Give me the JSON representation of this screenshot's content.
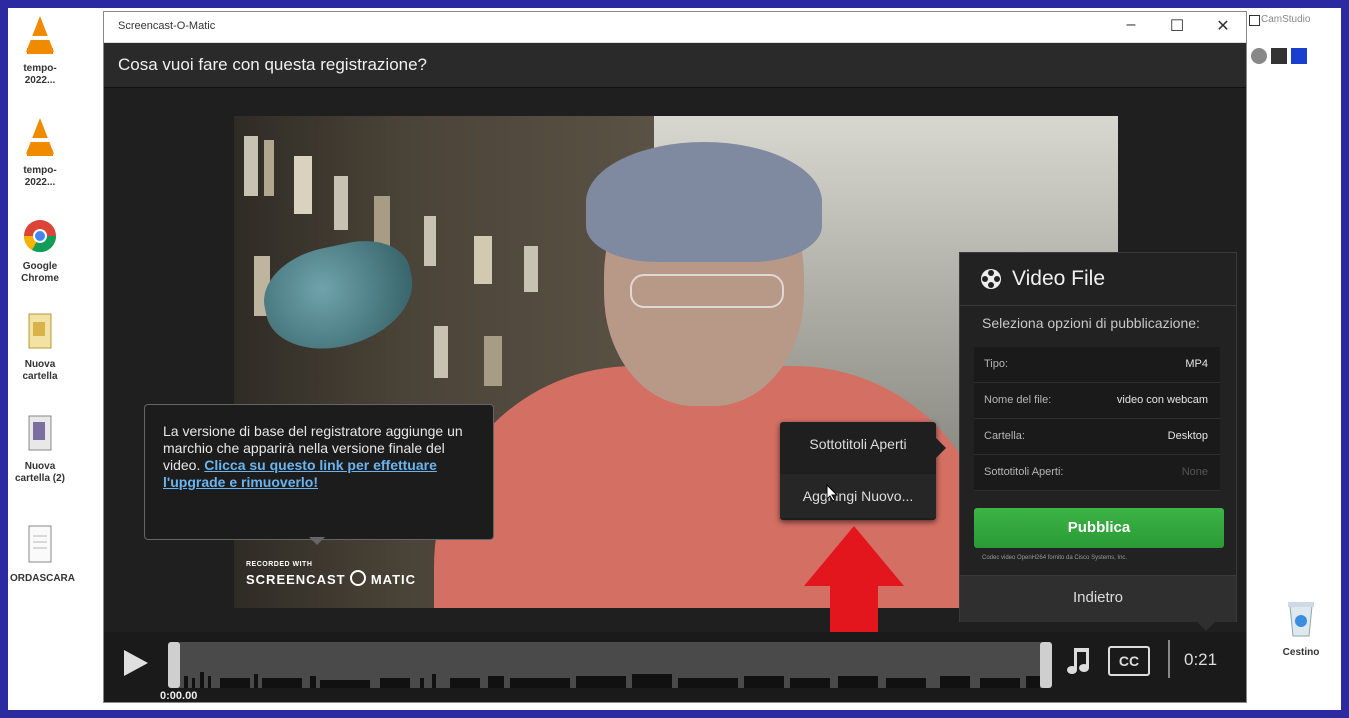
{
  "desktop": {
    "icons": [
      {
        "name": "vlc-icon",
        "label": "tempo-2022..."
      },
      {
        "name": "vlc-icon",
        "label": "tempo-2022..."
      },
      {
        "name": "chrome-icon",
        "label": "Google Chrome"
      },
      {
        "name": "folder-icon",
        "label": "Nuova cartella"
      },
      {
        "name": "folder-icon",
        "label": "Nuova cartella (2)"
      },
      {
        "name": "document-icon",
        "label": "ORDASCARA"
      }
    ],
    "recycle_bin_label": "Cestino",
    "camstudio": {
      "title": "CamStudio"
    }
  },
  "window": {
    "app_title": "Screencast-O-Matic",
    "minimize": "–",
    "maximize": "☐",
    "close": "✕",
    "question": "Cosa vuoi fare con questa registrazione?"
  },
  "video": {
    "watermark_top": "RECORDED WITH",
    "watermark_brand": "SCREENCAST",
    "watermark_brand2": "MATIC"
  },
  "tooltip": {
    "text": "La versione di base del registratore aggiunge un marchio che apparirà nella versione finale del video.",
    "link": "Clicca su questo link per effettuare l'upgrade e rimuoverlo!"
  },
  "menu": {
    "items": [
      "Sottotitoli Aperti",
      "Aggiungi Nuovo..."
    ]
  },
  "panel": {
    "title": "Video File",
    "subtitle": "Seleziona opzioni di pubblicazione:",
    "rows": [
      {
        "key": "Tipo:",
        "value": "MP4"
      },
      {
        "key": "Nome del file:",
        "value": "video con webcam"
      },
      {
        "key": "Cartella:",
        "value": "Desktop"
      },
      {
        "key": "Sottotitoli Aperti:",
        "value": "None"
      }
    ],
    "publish": "Pubblica",
    "codec": "Codec video OpenH264 fornito da Cisco Systems, Inc.",
    "back": "Indietro"
  },
  "controls": {
    "start_time": "0:00.00",
    "cc": "CC",
    "duration": "0:21"
  },
  "colors": {
    "frame": "#2b2aa0",
    "publish_green": "#34a93f",
    "arrow_red": "#e3151d",
    "link_blue": "#6ab4ef"
  }
}
